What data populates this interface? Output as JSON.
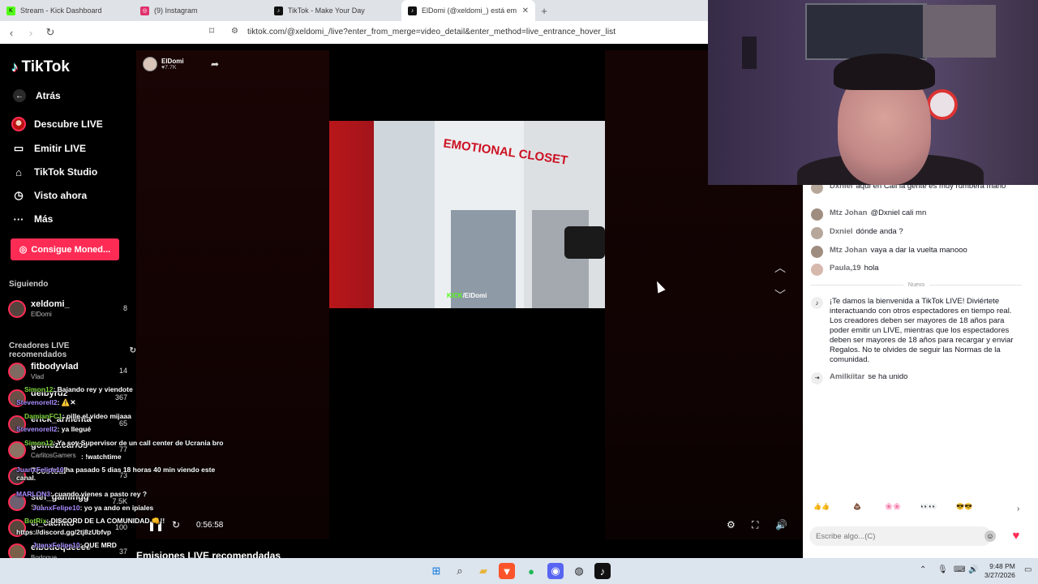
{
  "browser": {
    "tabs": [
      {
        "title": "Stream - Kick Dashboard",
        "color": "#53fc18",
        "glyph": "K"
      },
      {
        "title": "(9) Instagram",
        "color": "#e1306c",
        "glyph": "◎"
      },
      {
        "title": "TikTok - Make Your Day",
        "color": "#111111",
        "glyph": "♪"
      },
      {
        "title": "ElDomi (@xeldomi_) está em",
        "color": "#111111",
        "glyph": "♪"
      }
    ],
    "url": "tiktok.com/@xeldomi_/live?enter_from_merge=video_detail&enter_method=live_entrance_hover_list"
  },
  "sidebar": {
    "logo": "TikTok",
    "back": "Atrás",
    "nav": [
      "Descubre LIVE",
      "Emitir LIVE",
      "TikTok Studio",
      "Visto ahora",
      "Más"
    ],
    "coins": "Consigue Moned...",
    "following_title": "Siguiendo",
    "following": {
      "name": "xeldomi_",
      "sub": "ElDomi",
      "count": "8"
    },
    "recommended_title": "Creadores LIVE recomendados",
    "recommended": [
      {
        "name": "fitbodyvlad",
        "sub": "Vlad",
        "count": "14"
      },
      {
        "name": "deibyrdz",
        "sub": "",
        "count": "367"
      },
      {
        "name": "erick_armenta",
        "sub": "",
        "count": "65"
      },
      {
        "name": "gomez.carlos",
        "sub": "CarlitosGamers",
        "count": "77"
      },
      {
        "name": "7ccsteal",
        "sub": "",
        "count": "73"
      },
      {
        "name": "stef_gamingg",
        "sub": "Stef",
        "count": "7.5K"
      },
      {
        "name": "el_cachito",
        "sub": "",
        "count": "100"
      },
      {
        "name": "elbodoqueeee",
        "sub": "Bodoque",
        "count": "37"
      }
    ]
  },
  "player": {
    "host_name": "ElDomi",
    "host_likes": "♥7.7K",
    "watermark_brand": "KICK",
    "watermark_name": "/ElDomi",
    "shirt_text": "EMOTIONAL CLOSET",
    "time": "0:56:58"
  },
  "recommended_streams": "Emisiones LIVE recomendadas",
  "overlay_chat": [
    {
      "user": "Simon12",
      "text": ": Bajando rey y viendote"
    },
    {
      "user": "Stevenorell2",
      "text": ": ⚠️✕"
    },
    {
      "user": "DamianFC1",
      "text": ": pille el video mijaaa"
    },
    {
      "user": "Stevenorell2",
      "text": ": ya llegué"
    },
    {
      "user": "Simon12",
      "text": ": Ya soy Supervisor de un call center de Ucrania bro"
    },
    {
      "user": "",
      "text": ": !watchtime"
    },
    {
      "user": "JuanxFelipe10",
      "text": " ha pasado 5 dias 18 horas 40 min viendo este canal."
    },
    {
      "user": "MARLON3",
      "text": ": cuando vienes a pasto rey ?"
    },
    {
      "user": "JuanxFelipe10",
      "text": ": yo ya ando en ipiales"
    },
    {
      "user": "BotRix",
      "text": ": DISCORD DE LA COMUNIDAD 👊!!"
    },
    {
      "user": "",
      "text": "https://discord.gg/2tj8zUbfvp"
    },
    {
      "user": "JuanxFelipe10",
      "text": ": QUE MRD"
    }
  ],
  "chat": {
    "messages": [
      {
        "user": "Dxniel",
        "text": "aquí en Cali la gente es muy rumbera mano"
      },
      {
        "user": "Mtz Johan",
        "text": "@Dxniel cali mn"
      },
      {
        "user": "Dxniel",
        "text": "dónde anda ?"
      },
      {
        "user": "Mtz Johan",
        "text": "vaya a dar la vuelta manooo"
      },
      {
        "user": "Paula,19",
        "text": "hola"
      }
    ],
    "divider": "Nuevo",
    "welcome": "¡Te damos la bienvenida a TikTok LIVE! Diviértete interactuando con otros espectadores en tiempo real. Los creadores deben ser mayores de 18 años para poder emitir un LIVE, mientras que los espectadores deben ser mayores de 18 años para recargar y enviar Regalos. No te olvides de seguir las Normas de la comunidad.",
    "joined_user": "Amilkiitar",
    "joined_text": "se ha unido",
    "quick_reactions": [
      "👍👍",
      "💩",
      "🌸🌸",
      "👀👀",
      "😎😎"
    ],
    "placeholder": "Escribe algo...(C)"
  },
  "taskbar": {
    "time": "9:48 PM",
    "date": "3/27/2026"
  }
}
